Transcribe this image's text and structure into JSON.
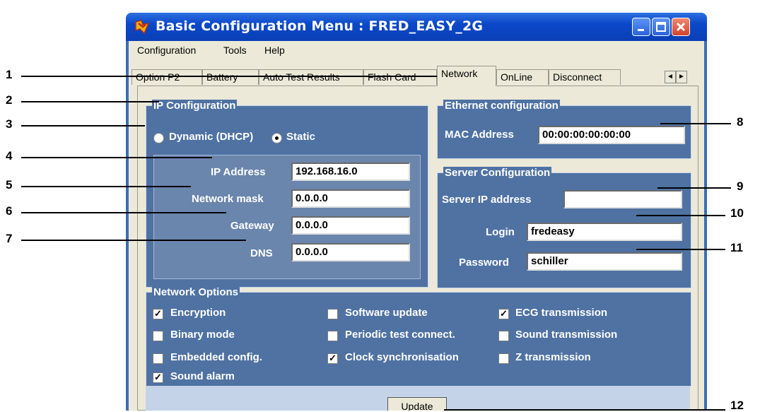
{
  "window": {
    "title": "Basic Configuration Menu : FRED_EASY_2G"
  },
  "menubar": [
    "Configuration",
    "Tools",
    "Help"
  ],
  "tabs": [
    "Option P2",
    "Battery",
    "Auto Test Results",
    "Flash Card",
    "Network",
    "OnLine",
    "Disconnect"
  ],
  "tab_scroll": {
    "left": "◄",
    "right": "►"
  },
  "ip_config": {
    "title": "IP Configuration",
    "dynamic_label": "Dynamic (DHCP)",
    "static_label": "Static",
    "mode": "Static",
    "ip_label": "IP Address",
    "ip_value": "192.168.16.0",
    "mask_label": "Network mask",
    "mask_value": "0.0.0.0",
    "gateway_label": "Gateway",
    "gateway_value": "0.0.0.0",
    "dns_label": "DNS",
    "dns_value": "0.0.0.0"
  },
  "ethernet": {
    "title": "Ethernet configuration",
    "mac_label": "MAC Address",
    "mac_value": "00:00:00:00:00:00"
  },
  "server": {
    "title": "Server Configuration",
    "ip_label": "Server IP address",
    "ip_value": "",
    "login_label": "Login",
    "login_value": "fredeasy",
    "password_label": "Password",
    "password_value": "schiller"
  },
  "network_options": {
    "title": "Network Options",
    "items": [
      {
        "label": "Encryption",
        "checked": true
      },
      {
        "label": "Binary mode",
        "checked": false
      },
      {
        "label": "Embedded config.",
        "checked": false
      },
      {
        "label": "Sound alarm",
        "checked": true
      },
      {
        "label": "Software update",
        "checked": false
      },
      {
        "label": "Periodic test connect.",
        "checked": false
      },
      {
        "label": "Clock synchronisation",
        "checked": true
      },
      {
        "label": "ECG transmission",
        "checked": true
      },
      {
        "label": "Sound transmission",
        "checked": false
      },
      {
        "label": "Z transmission",
        "checked": false
      }
    ]
  },
  "update_button": "Update",
  "callouts": [
    "1",
    "2",
    "3",
    "4",
    "5",
    "6",
    "7",
    "8",
    "9",
    "10",
    "11",
    "12"
  ],
  "colors": {
    "titlebar": "#0a48c9",
    "group_bg": "#4f72a3",
    "window_bg": "#ece9d8"
  }
}
